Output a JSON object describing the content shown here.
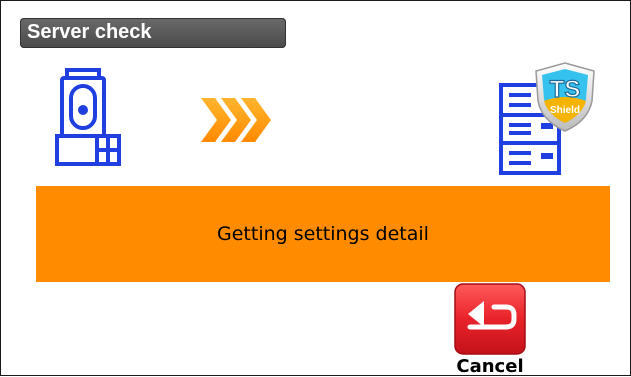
{
  "window": {
    "title": "Server check"
  },
  "graphics": {
    "source_device": "total-station-icon",
    "transfer_direction": "arrows-right-icon",
    "target": "server-icon",
    "target_badge": "ts-shield-badge-icon",
    "badge_text_main": "TS",
    "badge_text_sub": "Shield"
  },
  "status": {
    "message": "Getting settings detail",
    "color": "#ff8c00"
  },
  "actions": {
    "cancel_label": "Cancel",
    "cancel_icon": "return-arrow-icon",
    "cancel_color": "#e8232a"
  },
  "colors": {
    "device_blue": "#1f3fe0",
    "arrow_orange": "#ffa500",
    "title_bar": "#555555"
  }
}
